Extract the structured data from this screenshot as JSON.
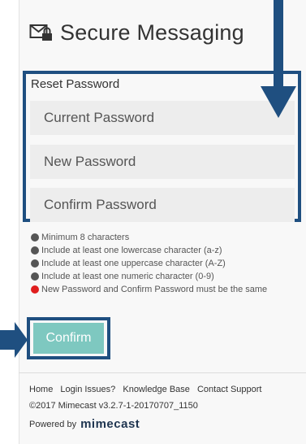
{
  "header": {
    "title": "Secure Messaging",
    "icon": "envelope-lock-icon"
  },
  "form": {
    "section_label": "Reset Password",
    "current_password_placeholder": "Current Password",
    "new_password_placeholder": "New Password",
    "confirm_password_placeholder": "Confirm Password"
  },
  "rules": [
    {
      "text": "Minimum 8 characters",
      "status": "gray"
    },
    {
      "text": "Include at least one lowercase character (a-z)",
      "status": "gray"
    },
    {
      "text": "Include at least one uppercase character (A-Z)",
      "status": "gray"
    },
    {
      "text": "Include at least one numeric character (0-9)",
      "status": "gray"
    },
    {
      "text": "New Password and Confirm Password must be the same",
      "status": "red"
    }
  ],
  "confirm_button": {
    "label": "Confirm"
  },
  "footer": {
    "links": [
      "Home",
      "Login Issues?",
      "Knowledge Base",
      "Contact Support"
    ],
    "copyright": "©2017 Mimecast v3.2.7-1-20170707_1150",
    "powered_by": "Powered by",
    "brand": "mimecast"
  },
  "colors": {
    "annotation_blue": "#1f4f80",
    "button_teal": "#7ec8c0",
    "status_red": "#e01e1e",
    "status_gray": "#555555"
  }
}
